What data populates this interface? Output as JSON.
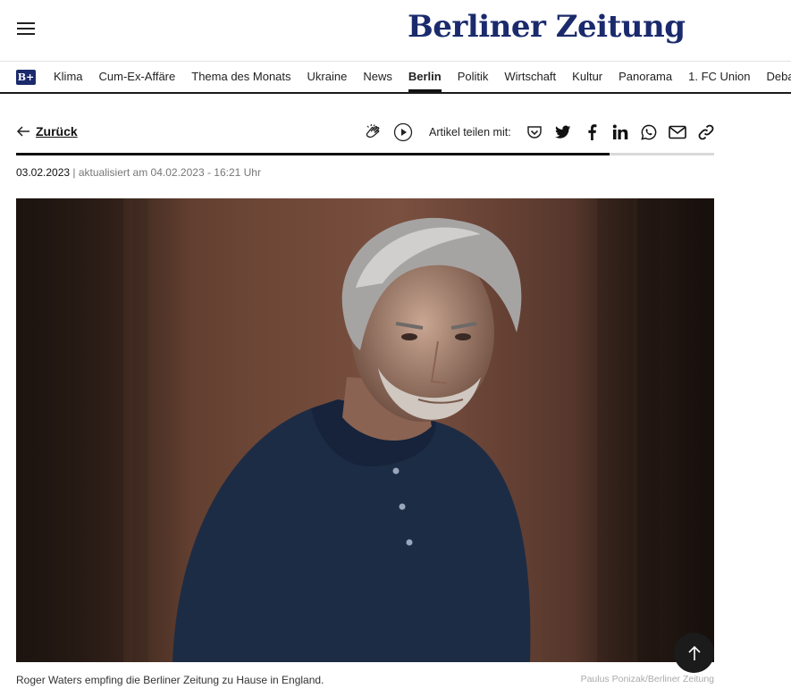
{
  "header": {
    "menu_icon": "hamburger-menu-icon",
    "logo_text": "Berliner Zeitung"
  },
  "nav": {
    "bplus_label": "B+",
    "items": [
      {
        "label": "Klima"
      },
      {
        "label": "Cum-Ex-Affäre"
      },
      {
        "label": "Thema des Monats"
      },
      {
        "label": "Ukraine"
      },
      {
        "label": "News"
      },
      {
        "label": "Berlin",
        "active": true
      },
      {
        "label": "Politik"
      },
      {
        "label": "Wirtschaft"
      },
      {
        "label": "Kultur"
      },
      {
        "label": "Panorama"
      },
      {
        "label": "1. FC Union"
      },
      {
        "label": "Debatte"
      }
    ]
  },
  "article": {
    "back_label": "Zurück",
    "share_label": "Artikel teilen mit:",
    "toolbar_icons": [
      "clap-icon",
      "play-icon"
    ],
    "share_icons": [
      "pocket-icon",
      "twitter-icon",
      "facebook-icon",
      "linkedin-icon",
      "whatsapp-icon",
      "mail-icon",
      "link-icon"
    ],
    "reading_progress": 0.85,
    "published": "03.02.2023",
    "updated": "| aktualisiert am 04.02.2023 - 16:21 Uhr",
    "image_caption": "Roger Waters empfing die Berliner Zeitung zu Hause in England.",
    "image_credit": "Paulus Ponizak/Berliner Zeitung"
  },
  "colors": {
    "brand": "#1a2a6c",
    "text": "#111111",
    "muted": "#777777"
  }
}
